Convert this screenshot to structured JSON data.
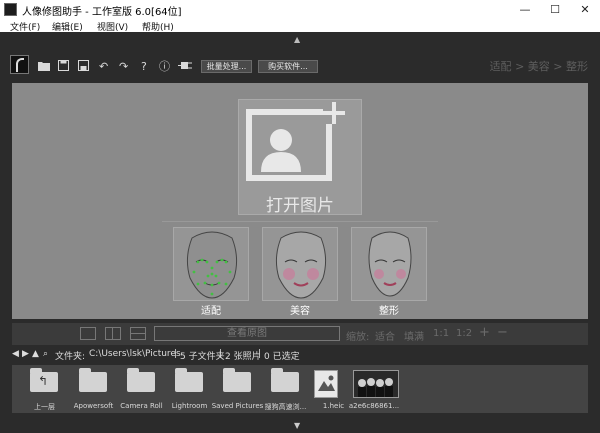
{
  "window": {
    "title": "人像修图助手 - 工作室版 6.0[64位]",
    "minimize": "—",
    "maximize": "☐",
    "close": "✕"
  },
  "menu": {
    "file": "文件(F)",
    "edit": "编辑(E)",
    "view": "视图(V)",
    "help": "帮助(H)"
  },
  "toolbar": {
    "batch_label": "批量处理...",
    "buy_label": "购买软件...",
    "icons": [
      "logo-icon",
      "open-folder-icon",
      "save-icon",
      "save-as-icon",
      "undo-icon",
      "redo-icon",
      "help-icon",
      "info-icon",
      "plugin-icon"
    ]
  },
  "breadcrumb": {
    "step1": "适配",
    "sep1": ">",
    "step2": "美容",
    "sep2": ">",
    "step3": "整形"
  },
  "canvas": {
    "open_label": "打开图片",
    "modes": [
      {
        "label": "适配"
      },
      {
        "label": "美容"
      },
      {
        "label": "整形"
      }
    ]
  },
  "viewbar": {
    "view_original": "查看原图",
    "zoom_label": "缩放:",
    "fit": "适合",
    "fill": "填满",
    "one_to_one": "1:1",
    "one_to_two": "1:2"
  },
  "pathbar": {
    "folder_label": "文件夹:",
    "path": "C:\\Users\\lsk\\Pictures",
    "subfolders": "5 子文件夹",
    "photos": "2 张照片",
    "selected": "0 已选定"
  },
  "thumbnails": [
    {
      "label": "上一层",
      "kind": "up"
    },
    {
      "label": "Apowersoft",
      "kind": "folder"
    },
    {
      "label": "Camera Roll",
      "kind": "folder"
    },
    {
      "label": "Lightroom",
      "kind": "folder"
    },
    {
      "label": "Saved Pictures",
      "kind": "folder"
    },
    {
      "label": "搜狗高速浏...",
      "kind": "folder"
    },
    {
      "label": "1.heic",
      "kind": "image"
    },
    {
      "label": "a2e6c86861...",
      "kind": "photo"
    }
  ],
  "colors": {
    "app_bg": "#2b2b2b",
    "canvas_bg": "#8a8a8a",
    "thumbstrip_bg": "#444444"
  }
}
